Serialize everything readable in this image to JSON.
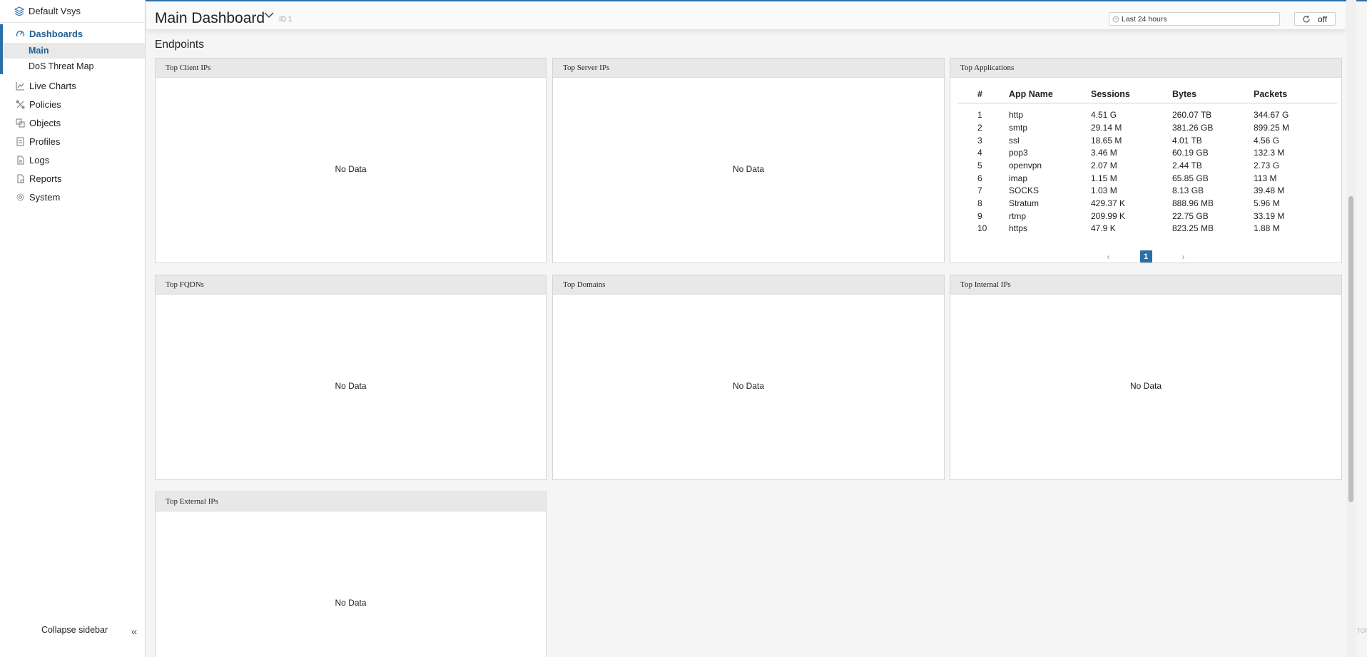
{
  "sidebar": {
    "vsys_label": "Default Vsys",
    "items": [
      {
        "label": "Dashboards"
      },
      {
        "label": "Live Charts"
      },
      {
        "label": "Policies"
      },
      {
        "label": "Objects"
      },
      {
        "label": "Profiles"
      },
      {
        "label": "Logs"
      },
      {
        "label": "Reports"
      },
      {
        "label": "System"
      }
    ],
    "sub_items": [
      {
        "label": "Main",
        "selected": true
      },
      {
        "label": "DoS Threat Map",
        "selected": false
      }
    ],
    "collapse_label": "Collapse sidebar"
  },
  "header": {
    "title": "Main Dashboard",
    "id_label": "ID 1",
    "time_range": "Last 24 hours",
    "refresh_label": "off"
  },
  "section_title": "Endpoints",
  "no_data": "No Data",
  "widgets": {
    "top_client_ips": "Top Client IPs",
    "top_server_ips": "Top Server IPs",
    "top_applications": "Top Applications",
    "top_fqdns": "Top FQDNs",
    "top_domains": "Top Domains",
    "top_internal_ips": "Top Internal IPs",
    "top_external_ips": "Top External IPs"
  },
  "apps_table": {
    "headers": [
      "#",
      "App Name",
      "Sessions",
      "Bytes",
      "Packets"
    ],
    "rows": [
      [
        "1",
        "http",
        "4.51 G",
        "260.07 TB",
        "344.67 G"
      ],
      [
        "2",
        "smtp",
        "29.14 M",
        "381.26 GB",
        "899.25 M"
      ],
      [
        "3",
        "ssl",
        "18.65 M",
        "4.01 TB",
        "4.56 G"
      ],
      [
        "4",
        "pop3",
        "3.46 M",
        "60.19 GB",
        "132.3 M"
      ],
      [
        "5",
        "openvpn",
        "2.07 M",
        "2.44 TB",
        "2.73 G"
      ],
      [
        "6",
        "imap",
        "1.15 M",
        "65.85 GB",
        "113 M"
      ],
      [
        "7",
        "SOCKS",
        "1.03 M",
        "8.13 GB",
        "39.48 M"
      ],
      [
        "8",
        "Stratum",
        "429.37 K",
        "888.96 MB",
        "5.96 M"
      ],
      [
        "9",
        "rtmp",
        "209.99 K",
        "22.75 GB",
        "33.19 M"
      ],
      [
        "10",
        "https",
        "47.9 K",
        "823.25 MB",
        "1.88 M"
      ]
    ],
    "page": "1",
    "prev_icon": "chevron-left-icon",
    "next_icon": "chevron-right-icon"
  },
  "colors": {
    "accent": "#2a6fa8",
    "header_bg": "#e8e8e8"
  },
  "scroll": {
    "top_label": "TOP"
  }
}
